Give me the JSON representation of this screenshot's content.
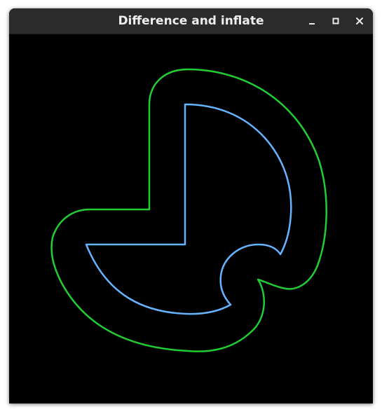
{
  "window": {
    "title": "Difference and inflate",
    "controls": {
      "minimize_icon": "minimize-icon",
      "maximize_icon": "maximize-icon",
      "close_icon": "close-icon"
    }
  },
  "canvas": {
    "background": "#000000",
    "shapes": [
      {
        "name": "inflated-outline",
        "color": "#22cc33"
      },
      {
        "name": "difference-shape",
        "color": "#66b3ff"
      }
    ]
  }
}
